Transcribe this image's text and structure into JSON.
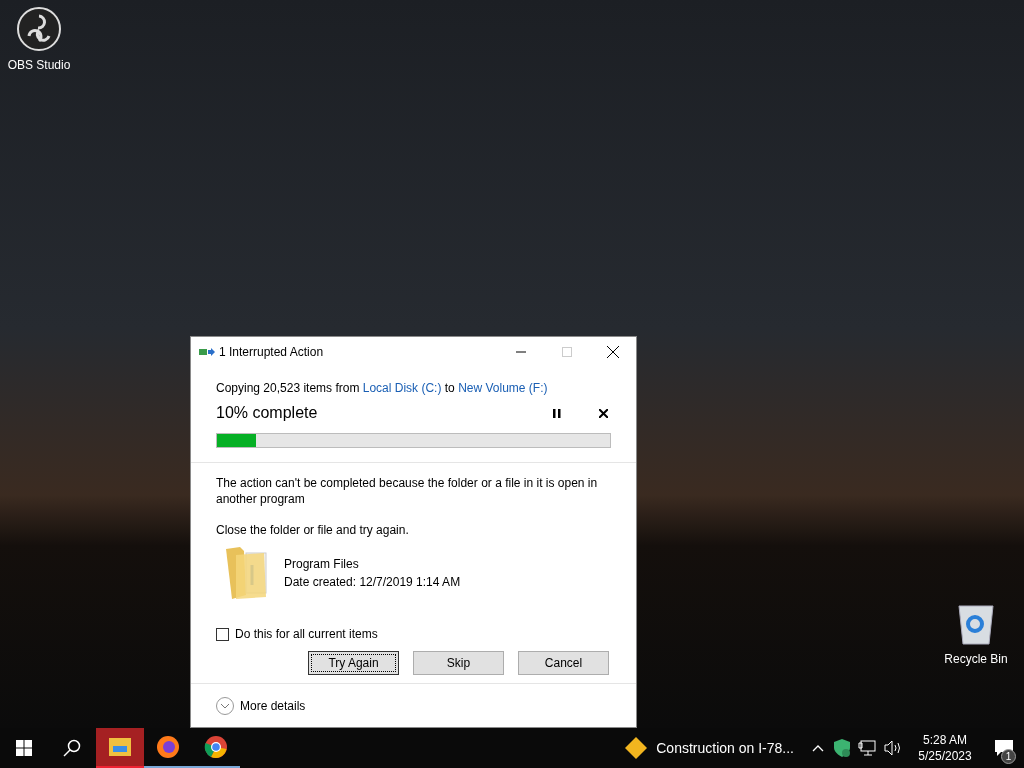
{
  "desktop_icons": [
    {
      "kind": "obs",
      "label": "OBS Studio"
    },
    {
      "kind": "recycle",
      "label": "Recycle Bin"
    }
  ],
  "dialog": {
    "title": "1 Interrupted Action",
    "summary": [
      {
        "kind": "text",
        "text": "Copying 20,523 items from "
      },
      {
        "kind": "link",
        "text": "Local Disk (C:)"
      },
      {
        "kind": "text",
        "text": " to "
      },
      {
        "kind": "link",
        "text": "New Volume (F:)"
      }
    ],
    "progress": {
      "label": "10% complete",
      "level": 0.1
    },
    "message": "The action can't be completed because the folder or a file in it is open in another program",
    "instruction": "Close the folder or file and try again.",
    "file": {
      "name": "Program Files",
      "date": "Date created: 12/7/2019 1:14 AM"
    },
    "checkbox": {
      "label": "Do this for all current items",
      "checked": false
    },
    "buttons": [
      {
        "label": "Try Again",
        "focused": true
      },
      {
        "label": "Skip",
        "focused": false
      },
      {
        "label": "Cancel",
        "focused": false
      }
    ],
    "more_details": "More details"
  },
  "taskbar": {
    "apps": [
      {
        "kind": "explorer",
        "selected": true
      },
      {
        "kind": "firefox",
        "selected": false
      },
      {
        "kind": "chrome",
        "selected": false
      }
    ],
    "news": "Construction on I-78...",
    "time": "5:28 AM",
    "date": "5/25/2023",
    "notification_count": "1"
  }
}
